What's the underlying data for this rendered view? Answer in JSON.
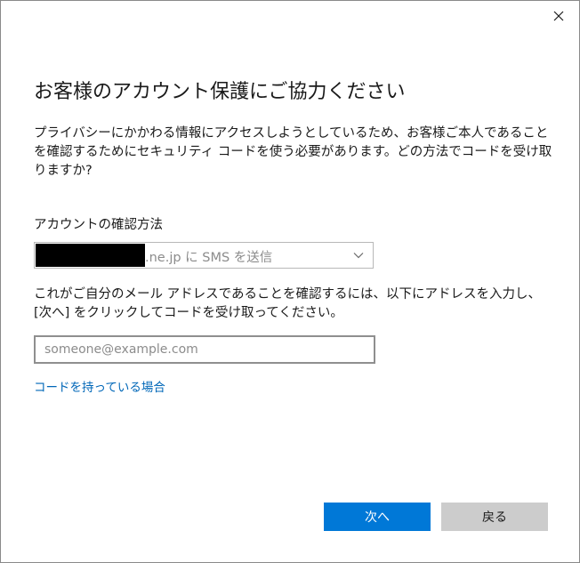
{
  "dialog": {
    "title": "お客様のアカウント保護にご協力ください",
    "description": "プライバシーにかかわる情報にアクセスしようとしているため、お客様ご本人であることを確認するためにセキュリティ コードを使う必要があります。どの方法でコードを受け取りますか?",
    "method_label": "アカウントの確認方法",
    "method_select": {
      "selected_text": ".ne.jp に SMS を送信"
    },
    "instruction": "これがご自分のメール アドレスであることを確認するには、以下にアドレスを入力し、[次へ] をクリックしてコードを受け取ってください。",
    "email_input": {
      "value": "",
      "placeholder": "someone@example.com"
    },
    "have_code_link": "コードを持っている場合",
    "buttons": {
      "next_label": "次へ",
      "back_label": "戻る"
    },
    "icons": {
      "close": "close-icon",
      "dropdown": "chevron-down-icon"
    },
    "colors": {
      "accent": "#0078d7",
      "link": "#0067b8",
      "secondary_button": "#cccccc",
      "redaction": "#000000"
    }
  }
}
